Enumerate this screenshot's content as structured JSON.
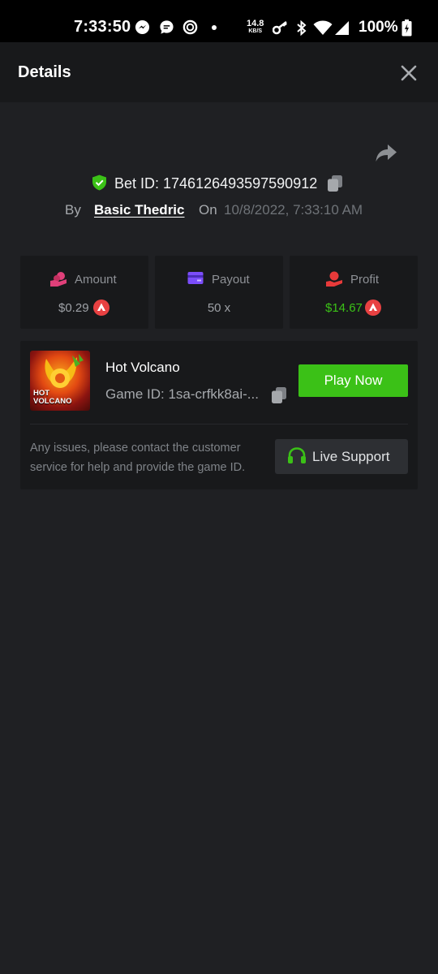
{
  "status_bar": {
    "time": "7:33:50",
    "net_speed_value": "14.8",
    "net_speed_unit": "KB/S",
    "battery": "100%"
  },
  "header": {
    "title": "Details"
  },
  "bet": {
    "bet_id_label": "Bet ID: 1746126493597590912",
    "by_label": "By",
    "username": "Basic Thedric",
    "on_label": "On",
    "date": "10/8/2022, 7:33:10 AM"
  },
  "stats": [
    {
      "title": "Amount",
      "value": "$0.29",
      "icon": "coins-hand-icon",
      "color": "#e0407a"
    },
    {
      "title": "Payout",
      "value": "50 x",
      "icon": "card-icon",
      "color": "#7b4dfa"
    },
    {
      "title": "Profit",
      "value": "$14.67",
      "icon": "money-hand-icon",
      "color": "#e83a3a",
      "value_color": "#3bc117"
    }
  ],
  "game": {
    "name": "Hot Volcano",
    "game_id": "Game ID: 1sa-crfkk8ai-...",
    "thumb_line1": "HOT",
    "thumb_line2": "VOLCANO",
    "play_label": "Play Now"
  },
  "support": {
    "message": "Any issues, please contact the customer service for help and provide the game ID.",
    "button_label": "Live Support"
  },
  "colors": {
    "accent_green": "#3bc117",
    "coin_red": "#e84142",
    "background": "#1f2023",
    "card": "#18191b"
  }
}
